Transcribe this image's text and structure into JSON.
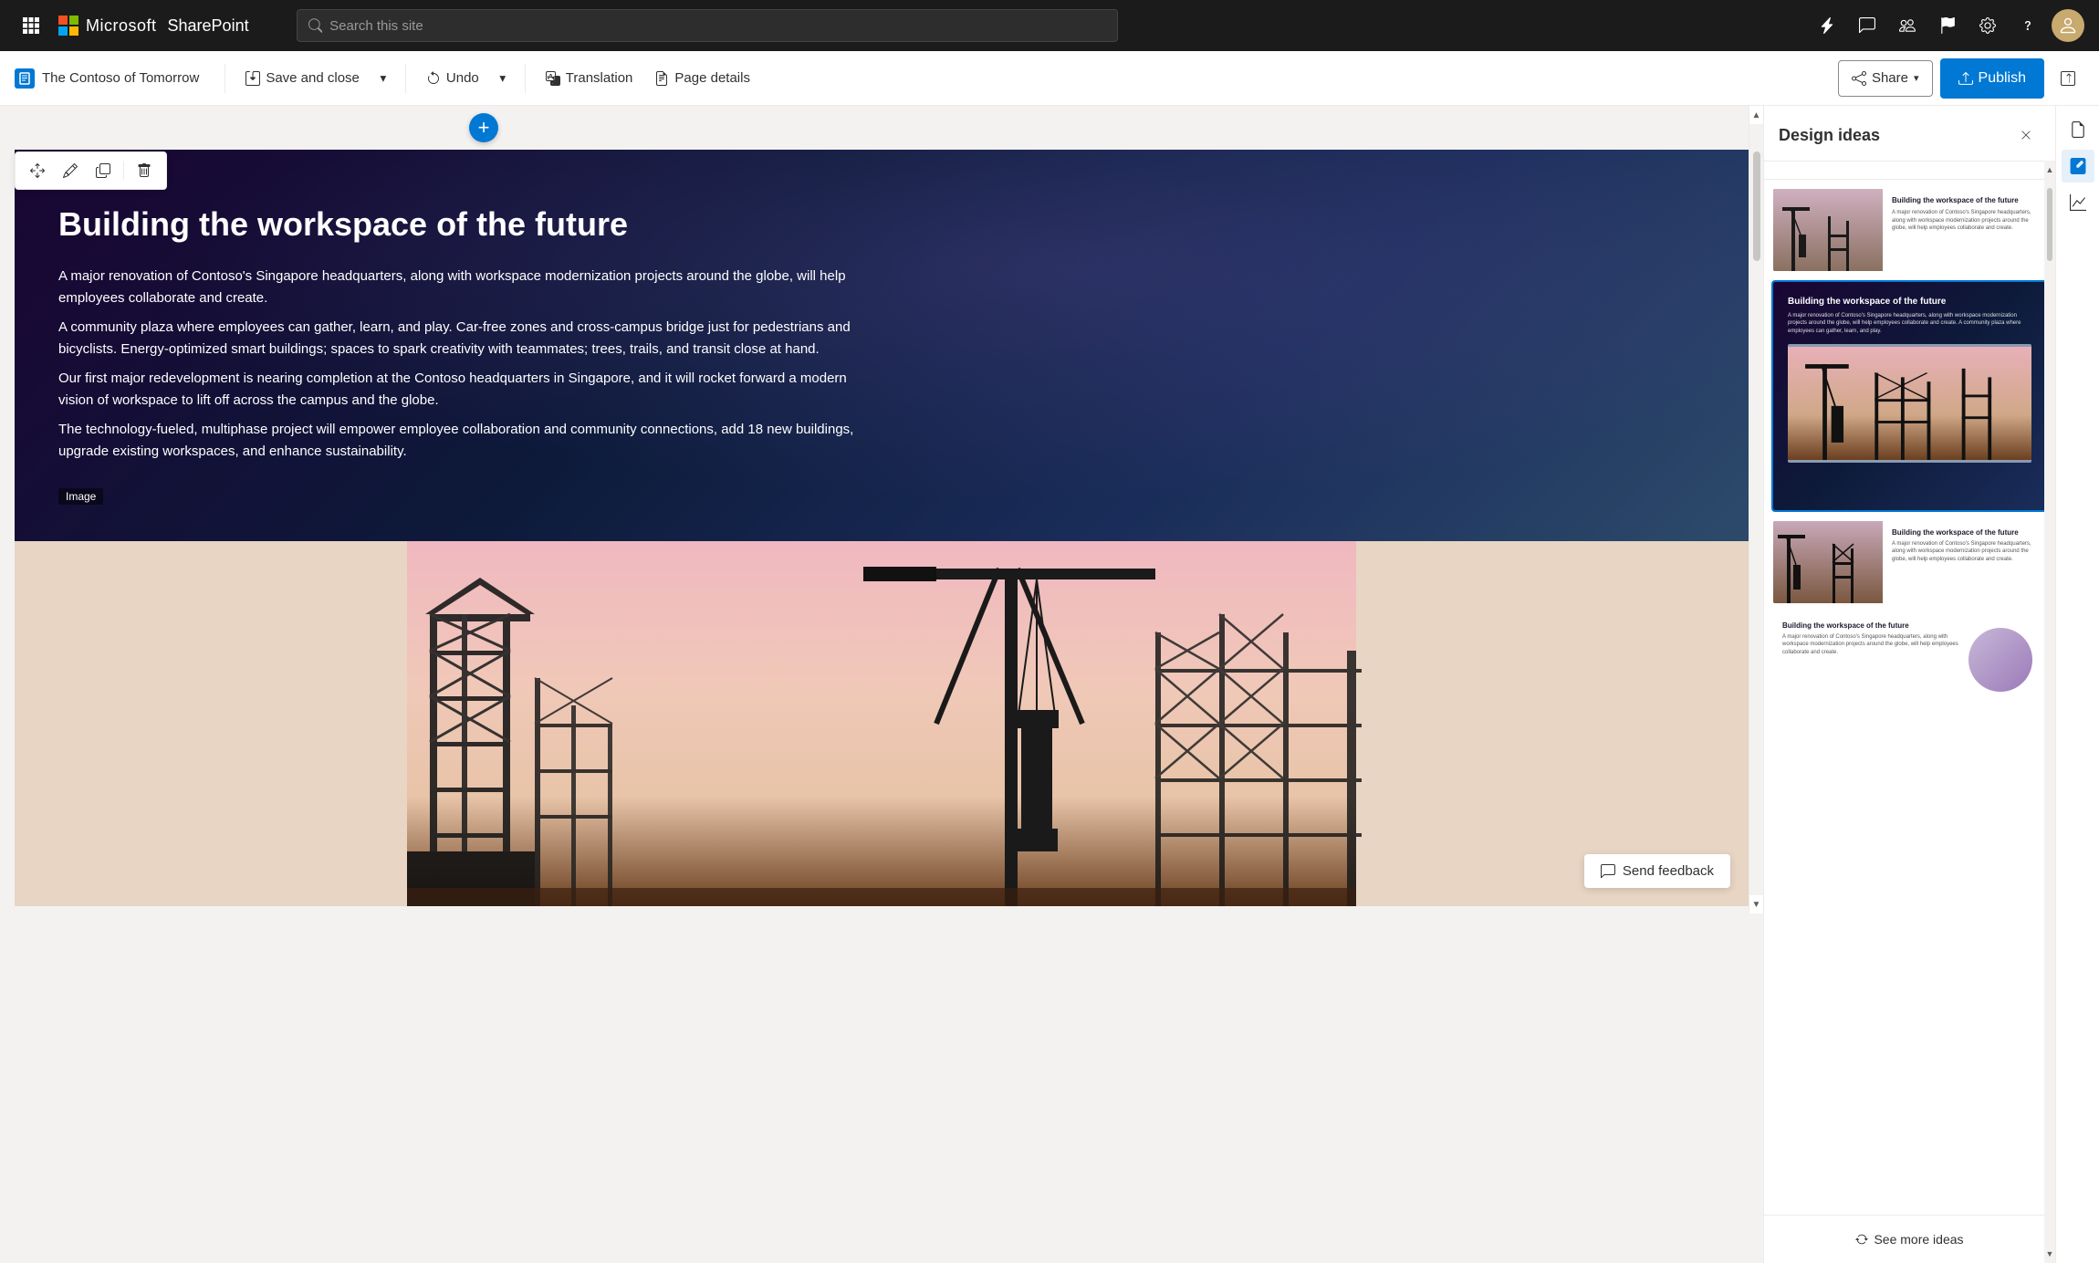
{
  "app": {
    "name": "Microsoft",
    "product": "SharePoint"
  },
  "nav": {
    "search_placeholder": "Search this site",
    "icons": [
      "waffle",
      "microsoft-logo",
      "sharepoint"
    ]
  },
  "toolbar": {
    "brand_label": "The Contoso of Tomorrow",
    "save_close_label": "Save and close",
    "undo_label": "Undo",
    "translation_label": "Translation",
    "page_details_label": "Page details",
    "share_label": "Share",
    "publish_label": "Publish"
  },
  "hero": {
    "title": "Building the workspace of the future",
    "body1": "A major renovation of Contoso's Singapore headquarters, along with workspace modernization projects around the globe, will help employees collaborate and create.",
    "body2": "A community plaza where employees can gather, learn, and play. Car-free zones and cross-campus bridge just for pedestrians and bicyclists. Energy-optimized smart buildings; spaces to spark creativity with teammates; trees, trails, and transit close at hand.",
    "body3": "Our first major redevelopment is nearing completion at the Contoso headquarters in Singapore, and it will rocket forward a modern vision of workspace to lift off across the campus and the globe.",
    "body4": "The technology-fueled, multiphase project will empower employee collaboration and community connections, add 18 new buildings, upgrade existing workspaces, and enhance sustainability.",
    "image_label": "Image"
  },
  "design_panel": {
    "title": "Design ideas",
    "close_label": "×",
    "card1": {
      "title": "Building the workspace of the future",
      "body": "A major renovation of Contoso's Singapore headquarters..."
    },
    "card2": {
      "title": "Building the workspace of the future",
      "body": "A major renovation of Contoso's Singapore headquarters, along with workspace modernization projects around the globe..."
    },
    "card3": {
      "title": "Building the workspace of the future",
      "body": "A major renovation of Contoso's Singapore headquarters..."
    },
    "card4": {
      "title": "Building the workspace of the future",
      "body": "A major renovation of Contoso's Singapore headquarters..."
    },
    "see_more_label": "See more ideas"
  },
  "feedback": {
    "label": "Send feedback"
  },
  "colors": {
    "primary": "#0078d4",
    "selected_border": "#0078d4",
    "hero_bg": "#1a0533"
  }
}
